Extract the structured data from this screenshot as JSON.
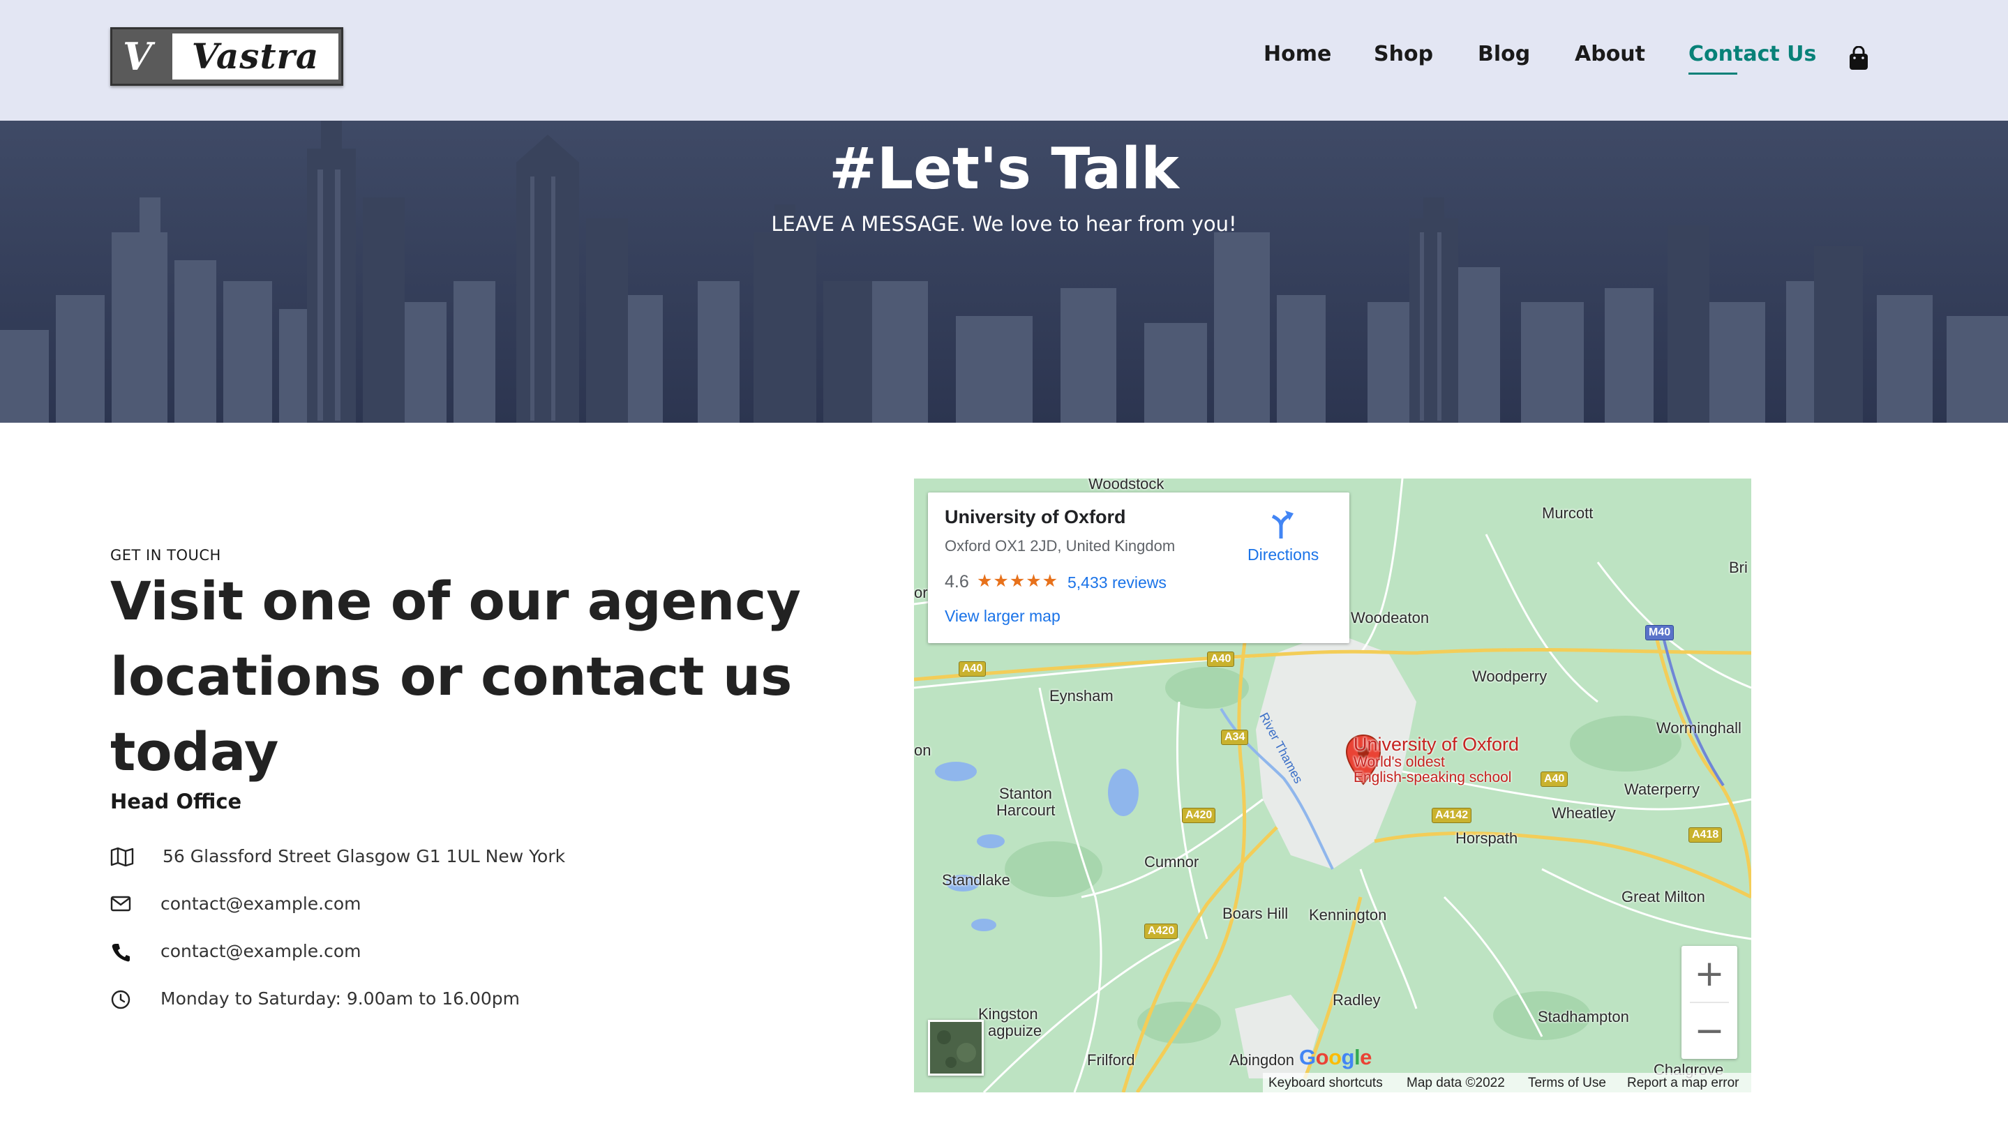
{
  "header": {
    "logo_mark": "V",
    "logo_word": "Vastra",
    "nav": [
      {
        "label": "Home",
        "active": false
      },
      {
        "label": "Shop",
        "active": false
      },
      {
        "label": "Blog",
        "active": false
      },
      {
        "label": "About",
        "active": false
      },
      {
        "label": "Contact Us",
        "active": true
      }
    ],
    "cart_icon": "shopping-bag-icon",
    "accent_color": "#088178",
    "background_color": "#e3e6f3"
  },
  "hero": {
    "title": "#Let's Talk",
    "subtitle": "LEAVE A MESSAGE. We love to hear from you!"
  },
  "contact": {
    "eyebrow": "GET IN TOUCH",
    "headline_lines": [
      "Visit one of our agency",
      "locations or contact us",
      "today"
    ],
    "office_title": "Head Office",
    "details": [
      {
        "icon": "map-icon",
        "text": "56 Glassford Street Glasgow G1 1UL New York"
      },
      {
        "icon": "envelope-icon",
        "text": "contact@example.com"
      },
      {
        "icon": "phone-icon",
        "text": "contact@example.com"
      },
      {
        "icon": "clock-icon",
        "text": "Monday to Saturday: 9.00am to 16.00pm"
      }
    ]
  },
  "map": {
    "card": {
      "title": "University of Oxford",
      "address": "Oxford OX1 2JD, United Kingdom",
      "rating": "4.6",
      "stars": "★★★★★",
      "reviews": "5,433 reviews",
      "larger_map": "View larger map",
      "directions": "Directions"
    },
    "pin": {
      "name": "University of Oxford",
      "line2": "World's oldest",
      "line3": "English-speaking school"
    },
    "places": [
      "Woodstock",
      "Murcott",
      "Bri",
      "Woodeaton",
      "Woodperry",
      "Eynsham",
      "Worminghall",
      "Stanton",
      "Harcourt",
      "Waterperry",
      "Wheatley",
      "Horspath",
      "Cumnor",
      "Standlake",
      "Great Milton",
      "Boars Hill",
      "Kennington",
      "Radley",
      "Kingston",
      "agpuize",
      "Stadhampton",
      "Frilford",
      "Abingdon",
      "Chalgrove",
      "or",
      "on"
    ],
    "roads": [
      "A40",
      "A40",
      "A34",
      "A420",
      "A420",
      "A40",
      "A4142",
      "A418",
      "M40"
    ],
    "river": "River Thames",
    "zoom_in": "+",
    "zoom_out": "−",
    "google": "Google",
    "footer": [
      "Keyboard shortcuts",
      "Map data ©2022",
      "Terms of Use",
      "Report a map error"
    ]
  }
}
